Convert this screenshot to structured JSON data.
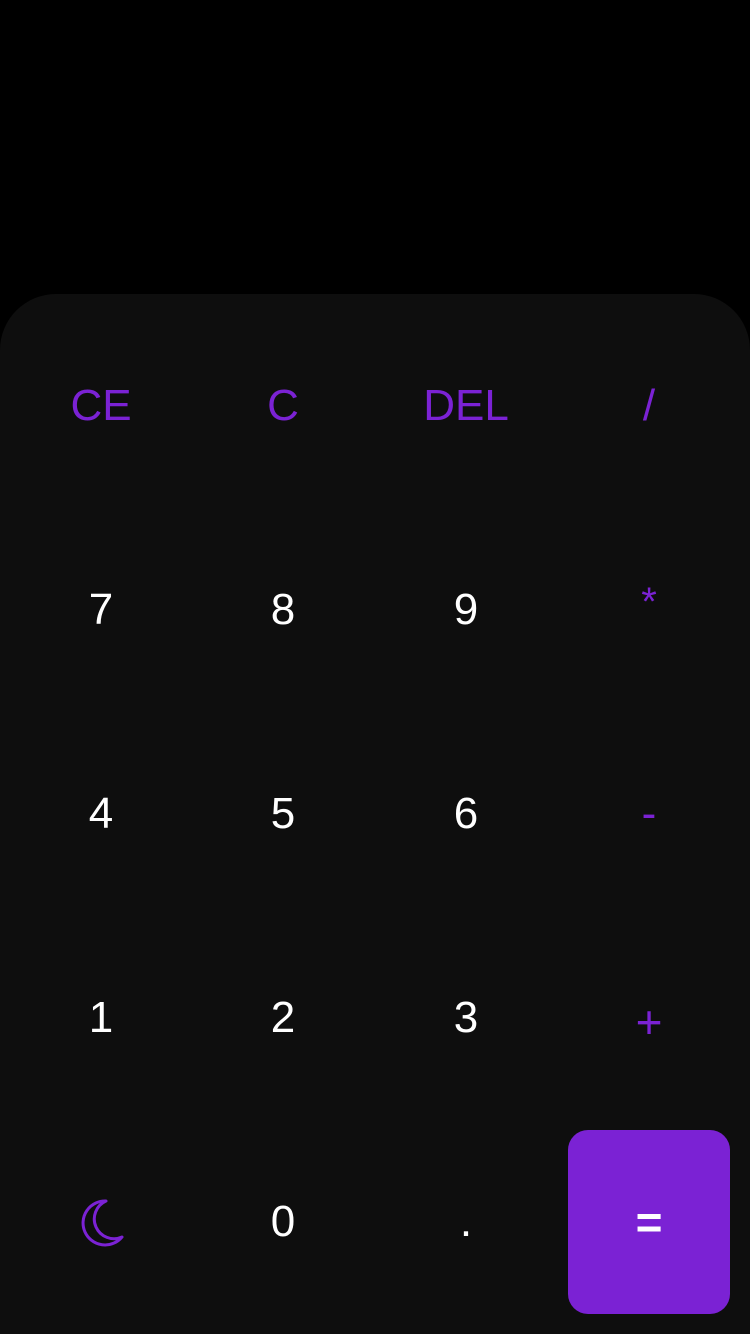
{
  "colors": {
    "accent": "#7b22d4",
    "keypad_bg": "#0e0e0e",
    "background": "#000000",
    "digit": "#ffffff"
  },
  "display": {
    "value": ""
  },
  "keys": {
    "ce": "CE",
    "c": "C",
    "del": "DEL",
    "divide": "/",
    "seven": "7",
    "eight": "8",
    "nine": "9",
    "multiply": "*",
    "four": "4",
    "five": "5",
    "six": "6",
    "minus": "-",
    "one": "1",
    "two": "2",
    "three": "3",
    "plus": "+",
    "theme_icon": "moon-icon",
    "zero": "0",
    "decimal": ".",
    "equals": "="
  }
}
